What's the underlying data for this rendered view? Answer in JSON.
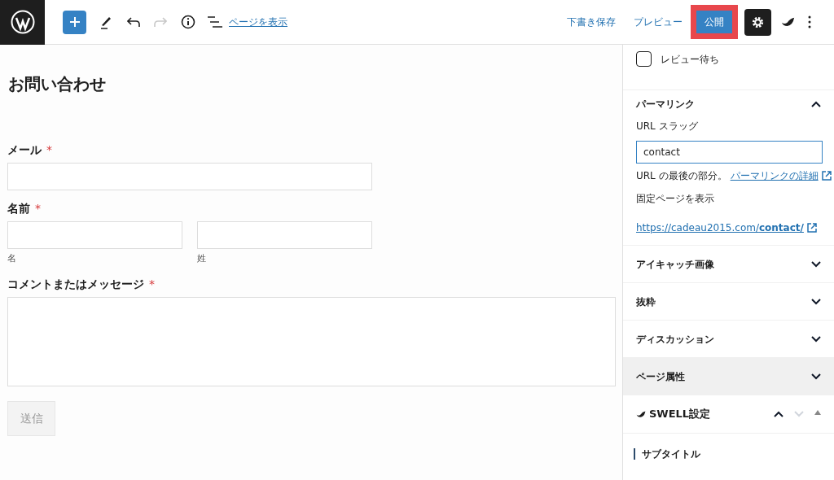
{
  "toolbar": {
    "view_link": "ページを表示",
    "redo_disabled": true,
    "save_draft": "下書き保存",
    "preview": "プレビュー",
    "publish": {
      "label": "公開",
      "highlighted": true
    },
    "settings_active": true
  },
  "editor": {
    "title": "お問い合わせ",
    "fields": [
      {
        "kind": "single",
        "label": "メール",
        "required": "*"
      },
      {
        "kind": "name",
        "label": "名前",
        "required": "*",
        "sublabels": [
          "名",
          "姓"
        ]
      },
      {
        "kind": "textarea",
        "label": "コメントまたはメッセージ",
        "required": "*"
      }
    ],
    "submit": "送信"
  },
  "sidebar": {
    "review": {
      "label": "レビュー待ち",
      "checked": false
    },
    "permalink": {
      "title": "パーマリンク",
      "expanded": true,
      "slug_label": "URL スラッグ",
      "slug_value": "contact",
      "help": "URL の最後の部分。",
      "help_link": "パーマリンクの詳細",
      "view_label": "固定ページを表示",
      "url": "https://cadeau2015.com/**contact/**"
    },
    "panels": [
      {
        "title": "アイキャッチ画像",
        "expanded": false,
        "hovered": false
      },
      {
        "title": "抜粋",
        "expanded": false,
        "hovered": false
      },
      {
        "title": "ディスカッション",
        "expanded": false,
        "hovered": false
      },
      {
        "title": "ページ属性",
        "expanded": false,
        "hovered": true
      }
    ],
    "swell": {
      "title": "SWELL設定",
      "subtitle": "サブタイトル"
    }
  }
}
